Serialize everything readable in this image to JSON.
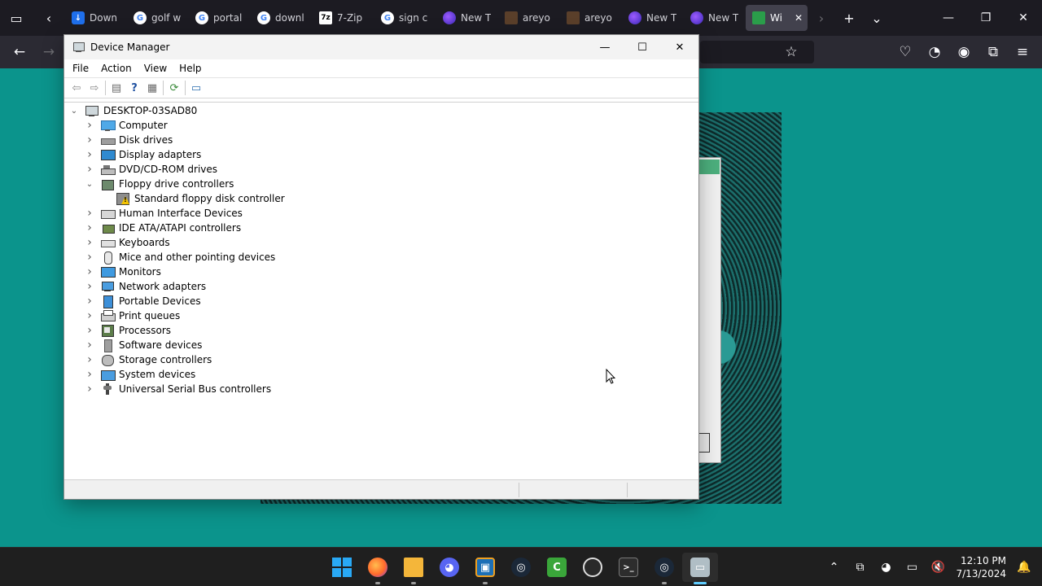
{
  "browser": {
    "tabs": [
      {
        "label": "Down",
        "icon": "download-icon"
      },
      {
        "label": "golf w",
        "icon": "google-icon"
      },
      {
        "label": "portal",
        "icon": "google-icon"
      },
      {
        "label": "downl",
        "icon": "google-icon"
      },
      {
        "label": "7-Zip",
        "icon": "7zip-icon"
      },
      {
        "label": "sign c",
        "icon": "google-icon"
      },
      {
        "label": "New T",
        "icon": "firefox-icon"
      },
      {
        "label": "areyo",
        "icon": "site-icon"
      },
      {
        "label": "areyo",
        "icon": "site-icon"
      },
      {
        "label": "New T",
        "icon": "firefox-icon"
      },
      {
        "label": "New T",
        "icon": "firefox-icon"
      },
      {
        "label": "Wi",
        "icon": "sheet-icon",
        "active": true
      }
    ],
    "close_glyph": "✕"
  },
  "device_manager": {
    "title": "Device Manager",
    "menu": [
      "File",
      "Action",
      "View",
      "Help"
    ],
    "root": "DESKTOP-03SAD80",
    "categories": [
      {
        "label": "Computer",
        "icon": "computer-icon",
        "expanded": false
      },
      {
        "label": "Disk drives",
        "icon": "disk-drive-icon",
        "expanded": false
      },
      {
        "label": "Display adapters",
        "icon": "display-adapter-icon",
        "expanded": false
      },
      {
        "label": "DVD/CD-ROM drives",
        "icon": "dvd-drive-icon",
        "expanded": false
      },
      {
        "label": "Floppy drive controllers",
        "icon": "floppy-controller-icon",
        "expanded": true,
        "children": [
          {
            "label": "Standard floppy disk controller",
            "icon": "warning-device-icon"
          }
        ]
      },
      {
        "label": "Human Interface Devices",
        "icon": "hid-icon",
        "expanded": false
      },
      {
        "label": "IDE ATA/ATAPI controllers",
        "icon": "ide-controller-icon",
        "expanded": false
      },
      {
        "label": "Keyboards",
        "icon": "keyboard-icon",
        "expanded": false
      },
      {
        "label": "Mice and other pointing devices",
        "icon": "mouse-icon",
        "expanded": false
      },
      {
        "label": "Monitors",
        "icon": "monitor-icon",
        "expanded": false
      },
      {
        "label": "Network adapters",
        "icon": "network-adapter-icon",
        "expanded": false
      },
      {
        "label": "Portable Devices",
        "icon": "portable-device-icon",
        "expanded": false
      },
      {
        "label": "Print queues",
        "icon": "printer-icon",
        "expanded": false
      },
      {
        "label": "Processors",
        "icon": "processor-icon",
        "expanded": false
      },
      {
        "label": "Software devices",
        "icon": "software-device-icon",
        "expanded": false
      },
      {
        "label": "Storage controllers",
        "icon": "storage-controller-icon",
        "expanded": false
      },
      {
        "label": "System devices",
        "icon": "system-device-icon",
        "expanded": false
      },
      {
        "label": "Universal Serial Bus controllers",
        "icon": "usb-icon",
        "expanded": false
      }
    ]
  },
  "taskbar": {
    "time": "12:10 PM",
    "date": "7/13/2024"
  },
  "colors": {
    "desktop": "#0b948c",
    "taskbar": "#1f1f1f",
    "browser_tabbar": "#1c1b22",
    "accent": "#60cdff"
  }
}
